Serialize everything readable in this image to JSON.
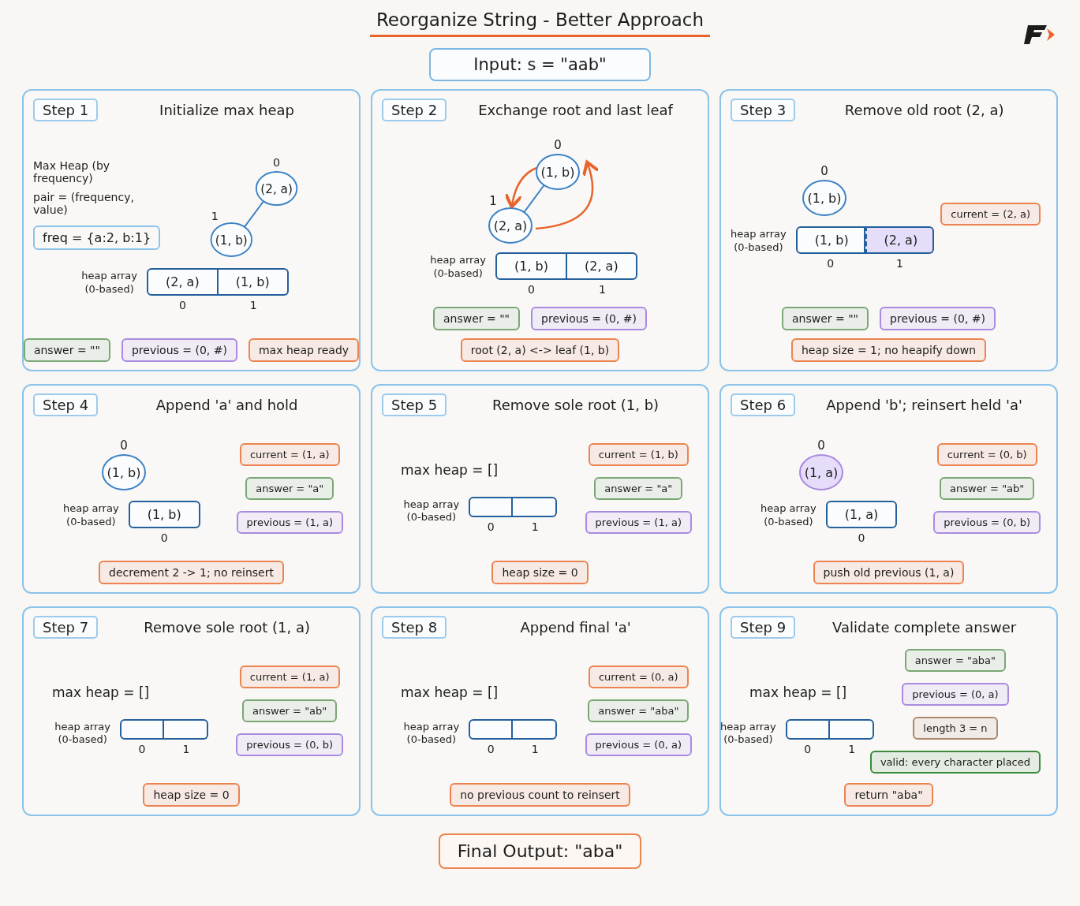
{
  "title": "Reorganize String - Better Approach",
  "input": "Input: s = \"aab\"",
  "steps": [
    {
      "label": "Step 1",
      "title": "Initialize max heap",
      "notes": [
        "Max Heap (by frequency)",
        "pair = (frequency, value)"
      ],
      "definition": "freq = {a:2, b:1}",
      "tree": {
        "root": {
          "index": "0",
          "value": "(2, a)",
          "highlighted": false,
          "children": [
            {
              "index": "1",
              "value": "(1, b)",
              "highlighted": false
            }
          ]
        }
      },
      "heap_array": {
        "label": "heap array",
        "sublabel": "(0-based)",
        "cells": [
          {
            "value": "(2, a)",
            "index": "0",
            "highlighted": false
          },
          {
            "value": "(1, b)",
            "index": "1",
            "highlighted": false
          }
        ]
      },
      "footer_rows": [
        [
          {
            "text": "answer = \"\"",
            "color": "#7aa874"
          },
          {
            "text": "previous = (0, #)",
            "color": "#a98be0"
          },
          {
            "text": "max heap ready",
            "color": "#ec8350"
          }
        ]
      ]
    },
    {
      "label": "Step 2",
      "title": "Exchange root and last leaf",
      "tree": {
        "swap": true,
        "root": {
          "index": "0",
          "value": "(1, b)",
          "highlighted": false,
          "children": [
            {
              "index": "1",
              "value": "(2, a)",
              "highlighted": false
            }
          ]
        }
      },
      "heap_array": {
        "label": "heap array",
        "sublabel": "(0-based)",
        "cells": [
          {
            "value": "(1, b)",
            "index": "0",
            "highlighted": false
          },
          {
            "value": "(2, a)",
            "index": "1",
            "highlighted": false
          }
        ]
      },
      "footer_rows": [
        [
          {
            "text": "answer = \"\"",
            "color": "#7aa874"
          },
          {
            "text": "previous = (0, #)",
            "color": "#a98be0"
          }
        ],
        [
          {
            "text": "root (2, a) <-> leaf (1, b)",
            "color": "#ec8350"
          }
        ]
      ]
    },
    {
      "label": "Step 3",
      "title": "Remove old root (2, a)",
      "tree": {
        "root": {
          "index": "0",
          "value": "(1, b)",
          "highlighted": false
        }
      },
      "heap_array": {
        "label": "heap array",
        "sublabel": "(0-based)",
        "cells": [
          {
            "value": "(1, b)",
            "index": "0",
            "highlighted": false
          },
          {
            "value": "(2, a)",
            "index": "1",
            "highlighted": true
          }
        ]
      },
      "side_tags": [
        {
          "text": "current = (2, a)",
          "color": "#ec8350"
        }
      ],
      "footer_rows": [
        [
          {
            "text": "answer = \"\"",
            "color": "#7aa874"
          },
          {
            "text": "previous = (0, #)",
            "color": "#a98be0"
          }
        ],
        [
          {
            "text": "heap size = 1; no heapify down",
            "color": "#ec8350"
          }
        ]
      ]
    },
    {
      "label": "Step 4",
      "title": "Append 'a' and hold",
      "tree": {
        "root": {
          "index": "0",
          "value": "(1, b)",
          "highlighted": false
        }
      },
      "heap_array": {
        "label": "heap array",
        "sublabel": "(0-based)",
        "cells": [
          {
            "value": "(1, b)",
            "index": "0",
            "highlighted": false
          }
        ]
      },
      "side_tags": [
        {
          "text": "current = (1, a)",
          "color": "#ec8350"
        },
        {
          "text": "answer = \"a\"",
          "color": "#7aa874"
        },
        {
          "text": "previous = (1, a)",
          "color": "#a98be0"
        }
      ],
      "footer_rows": [
        [
          {
            "text": "decrement 2 -> 1; no reinsert",
            "color": "#ec8350"
          }
        ]
      ]
    },
    {
      "label": "Step 5",
      "title": "Remove sole root (1, b)",
      "empty_heap": "max heap = []",
      "heap_array": {
        "label": "heap array",
        "sublabel": "(0-based)",
        "cells": [
          {
            "index": "0",
            "highlighted": false
          },
          {
            "index": "1",
            "highlighted": false
          }
        ]
      },
      "side_tags": [
        {
          "text": "current = (1, b)",
          "color": "#ec8350"
        },
        {
          "text": "answer = \"a\"",
          "color": "#7aa874"
        },
        {
          "text": "previous = (1, a)",
          "color": "#a98be0"
        }
      ],
      "footer_rows": [
        [
          {
            "text": "heap size = 0",
            "color": "#ec8350"
          }
        ]
      ]
    },
    {
      "label": "Step 6",
      "title": "Append 'b'; reinsert held 'a'",
      "tree": {
        "root": {
          "index": "0",
          "value": "(1, a)",
          "highlighted": true
        }
      },
      "heap_array": {
        "label": "heap array",
        "sublabel": "(0-based)",
        "cells": [
          {
            "value": "(1, a)",
            "index": "0",
            "highlighted": false
          }
        ]
      },
      "side_tags": [
        {
          "text": "current = (0, b)",
          "color": "#ec8350"
        },
        {
          "text": "answer = \"ab\"",
          "color": "#7aa874"
        },
        {
          "text": "previous = (0, b)",
          "color": "#a98be0"
        }
      ],
      "footer_rows": [
        [
          {
            "text": "push old previous (1, a)",
            "color": "#ec8350"
          }
        ]
      ]
    },
    {
      "label": "Step 7",
      "title": "Remove sole root (1, a)",
      "empty_heap": "max heap = []",
      "heap_array": {
        "label": "heap array",
        "sublabel": "(0-based)",
        "cells": [
          {
            "index": "0",
            "highlighted": false
          },
          {
            "index": "1",
            "highlighted": false
          }
        ]
      },
      "side_tags": [
        {
          "text": "current = (1, a)",
          "color": "#ec8350"
        },
        {
          "text": "answer = \"ab\"",
          "color": "#7aa874"
        },
        {
          "text": "previous = (0, b)",
          "color": "#a98be0"
        }
      ],
      "footer_rows": [
        [
          {
            "text": "heap size = 0",
            "color": "#ec8350"
          }
        ]
      ]
    },
    {
      "label": "Step 8",
      "title": "Append final 'a'",
      "empty_heap": "max heap = []",
      "heap_array": {
        "label": "heap array",
        "sublabel": "(0-based)",
        "cells": [
          {
            "index": "0",
            "highlighted": false
          },
          {
            "index": "1",
            "highlighted": false
          }
        ]
      },
      "side_tags": [
        {
          "text": "current = (0, a)",
          "color": "#ec8350"
        },
        {
          "text": "answer = \"aba\"",
          "color": "#7aa874"
        },
        {
          "text": "previous = (0, a)",
          "color": "#a98be0"
        }
      ],
      "footer_rows": [
        [
          {
            "text": "no previous count to reinsert",
            "color": "#ec8350"
          }
        ]
      ]
    },
    {
      "label": "Step 9",
      "title": "Validate complete answer",
      "empty_heap": "max heap = []",
      "heap_array": {
        "label": "heap array",
        "sublabel": "(0-based)",
        "cells": [
          {
            "index": "0",
            "highlighted": false
          },
          {
            "index": "1",
            "highlighted": false
          }
        ]
      },
      "side_tags": [
        {
          "text": "answer = \"aba\"",
          "color": "#7aa874"
        },
        {
          "text": "previous = (0, a)",
          "color": "#a98be0"
        },
        {
          "text": "length 3 = n",
          "color": "#b0866a"
        },
        {
          "text": "valid: every character placed",
          "color": "#3c8a3c"
        }
      ],
      "footer_rows": [
        [
          {
            "text": "return \"aba\"",
            "color": "#ec8350"
          }
        ]
      ]
    }
  ],
  "final_output": "Final Output: \"aba\""
}
